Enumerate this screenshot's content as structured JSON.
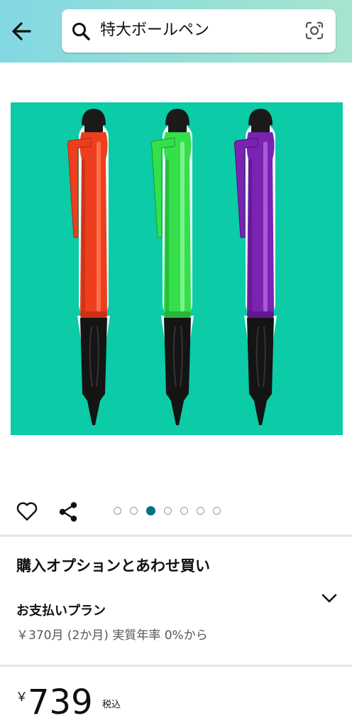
{
  "header": {
    "search_text": "特大ボールペン"
  },
  "product": {
    "pens": [
      {
        "color": "#ee3e1d",
        "highlight": "#ff7a55",
        "shade": "#b02a12"
      },
      {
        "color": "#33e04a",
        "highlight": "#8cf59a",
        "shade": "#1f9a2e"
      },
      {
        "color": "#7a22b2",
        "highlight": "#b06ae0",
        "shade": "#4e1275"
      }
    ],
    "background": "#0ccba7"
  },
  "carousel": {
    "dot_count": 7,
    "active_index": 2
  },
  "buy_options": {
    "title": "購入オプションとあわせ買い",
    "plan_title": "お支払いプラン",
    "plan_detail": "￥370月 (2か月) 実質年率 0%から"
  },
  "price": {
    "currency": "￥",
    "amount": "739",
    "tax_label": "税込"
  }
}
